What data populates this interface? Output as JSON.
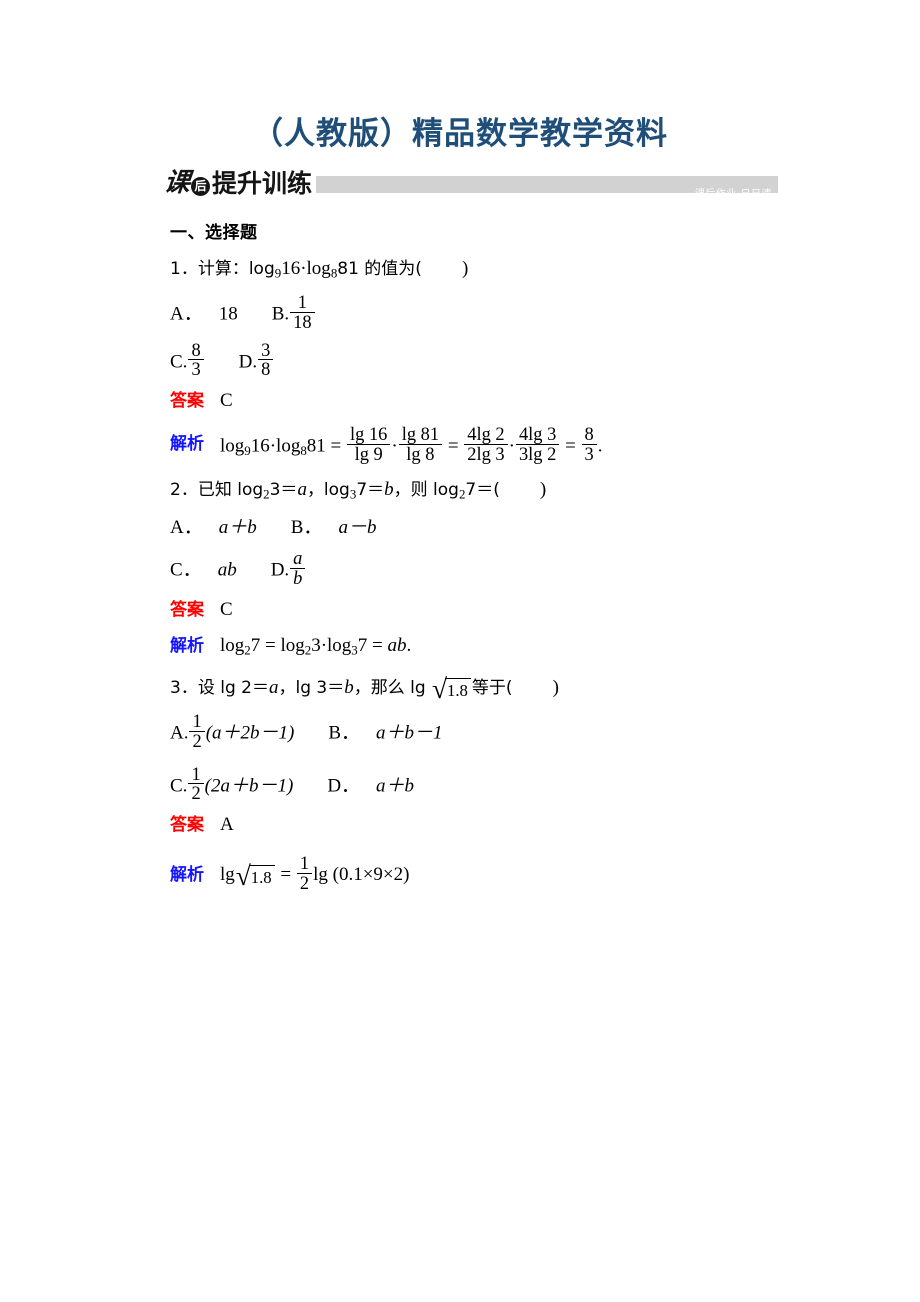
{
  "document": {
    "title": "（人教版）精品数学教学资料",
    "banner": {
      "logo_char": "课",
      "logo_stamp": "后",
      "logo_text": "提升训练",
      "tag": "课后作业·日日清"
    },
    "section_heading": "一、选择题",
    "colors": {
      "title": "#1F4E79",
      "answer_label": "#FF0000",
      "solution_label": "#1414FF",
      "banner_bar": "#D2D2D2"
    },
    "labels": {
      "answer": "答案",
      "solution": "解析"
    }
  },
  "questions": [
    {
      "number": "1．",
      "stem_prefix": "计算：log",
      "stem_base1": "9",
      "stem_mid": "16·log",
      "stem_base2": "8",
      "stem_suffix": "81 的值为(",
      "stem_close": ")",
      "options": {
        "A_label": "A．",
        "A_value": "18",
        "B_label": "B.",
        "B_num": "1",
        "B_den": "18",
        "C_label": "C.",
        "C_num": "8",
        "C_den": "3",
        "D_label": "D.",
        "D_num": "3",
        "D_den": "8"
      },
      "answer": "C",
      "solution": {
        "lhs_1": "log",
        "lhs_1_sub": "9",
        "lhs_2": "16·log",
        "lhs_2_sub": "8",
        "lhs_3": "81",
        "eq1": "=",
        "f1_num": "lg 16",
        "f1_den": "lg 9",
        "dot1": "·",
        "f2_num": "lg 81",
        "f2_den": "lg 8",
        "eq2": "=",
        "f3_num": "4lg 2",
        "f3_den": "2lg 3",
        "dot2": "·",
        "f4_num": "4lg 3",
        "f4_den": "3lg 2",
        "eq3": "=",
        "f5_num": "8",
        "f5_den": "3",
        "period": "."
      }
    },
    {
      "number": "2．",
      "stem_a": "已知 log",
      "stem_a_sub": "2",
      "stem_b": "3＝",
      "stem_b_var": "a",
      "stem_c": "，log",
      "stem_c_sub": "3",
      "stem_d": "7＝",
      "stem_d_var": "b",
      "stem_e": "，则 log",
      "stem_e_sub": "2",
      "stem_f": "7＝(",
      "stem_close": ")",
      "options": {
        "A_label": "A．",
        "A_value": "a＋b",
        "B_label": "B．",
        "B_value": "a－b",
        "C_label": "C．",
        "C_value": "ab",
        "D_label": "D.",
        "D_num": "a",
        "D_den": "b"
      },
      "answer": "C",
      "solution": {
        "t1": "log",
        "t1_sub": "2",
        "t2": "7 = log",
        "t2_sub": "2",
        "t3": "3·log",
        "t3_sub": "3",
        "t4": "7 = ",
        "t5": "ab",
        "period": "."
      }
    },
    {
      "number": "3．",
      "stem_a": "设 lg 2＝",
      "stem_a_var": "a",
      "stem_b": "，lg 3＝",
      "stem_b_var": "b",
      "stem_c": "，那么 lg ",
      "radicand": "1.8",
      "stem_d": "等于(",
      "stem_close": ")",
      "options": {
        "A_label": "A.",
        "A_num": "1",
        "A_den": "2",
        "A_expr": "(a＋2b－1)",
        "B_label": "B．",
        "B_value": "a＋b－1",
        "C_label": "C.",
        "C_num": "1",
        "C_den": "2",
        "C_expr": "(2a＋b－1)",
        "D_label": "D．",
        "D_value": "a＋b"
      },
      "answer": "A",
      "solution": {
        "lg": "lg",
        "radicand": "1.8",
        "eq": "=",
        "f_num": "1",
        "f_den": "2",
        "tail": "lg (0.1×9×2)"
      }
    }
  ]
}
